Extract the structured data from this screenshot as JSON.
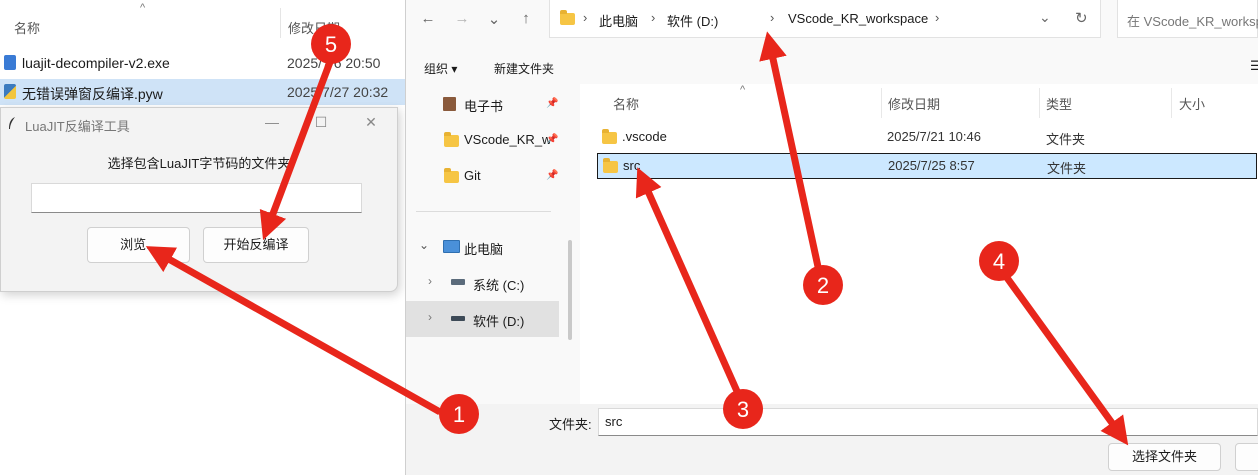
{
  "bg_explorer": {
    "col_name": "名称",
    "col_modified": "修改日期",
    "rows": [
      {
        "name": "luajit-decompiler-v2.exe",
        "date": "2025/7/6 20:50"
      },
      {
        "name": "无错误弹窗反编译.pyw",
        "date": "2025/7/27 20:32"
      }
    ]
  },
  "tool_window": {
    "title": "LuaJIT反编译工具",
    "minimize": "—",
    "maximize": "☐",
    "close": "✕",
    "prompt": "选择包含LuaJIT字节码的文件夹",
    "path_value": "",
    "browse_label": "浏览...",
    "decompile_label": "开始反编译"
  },
  "dialog": {
    "nav": {
      "back": "←",
      "forward": "→",
      "recent": "⌄",
      "up": "↑"
    },
    "breadcrumb": [
      "此电脑",
      "软件 (D:)",
      "VScode_KR_workspace"
    ],
    "crumb_sep": "›",
    "address_dropdown": "⌄",
    "refresh": "↻",
    "search_placeholder": "在 VScode_KR_workspace 中搜索",
    "toolbar": {
      "organize": "组织 ▾",
      "new_folder": "新建文件夹",
      "view": "☰"
    },
    "nav_pane": {
      "quick": [
        {
          "label": "电子书",
          "icon": "ebook-icon"
        },
        {
          "label": "VScode_KR_w",
          "icon": "folder-icon"
        },
        {
          "label": "Git",
          "icon": "folder-icon"
        }
      ],
      "this_pc": "此电脑",
      "drives": [
        {
          "label": "系统 (C:)"
        },
        {
          "label": "软件 (D:)"
        }
      ]
    },
    "columns": {
      "name": "名称",
      "modified": "修改日期",
      "type": "类型",
      "size": "大小"
    },
    "files": [
      {
        "name": ".vscode",
        "date": "2025/7/21 10:46",
        "type": "文件夹"
      },
      {
        "name": "src",
        "date": "2025/7/25 8:57",
        "type": "文件夹"
      }
    ],
    "folder_label": "文件夹:",
    "folder_value": "src",
    "select_folder": "选择文件夹"
  },
  "annotations": {
    "color": "#e8261b",
    "badges": [
      "1",
      "2",
      "3",
      "4",
      "5"
    ]
  }
}
